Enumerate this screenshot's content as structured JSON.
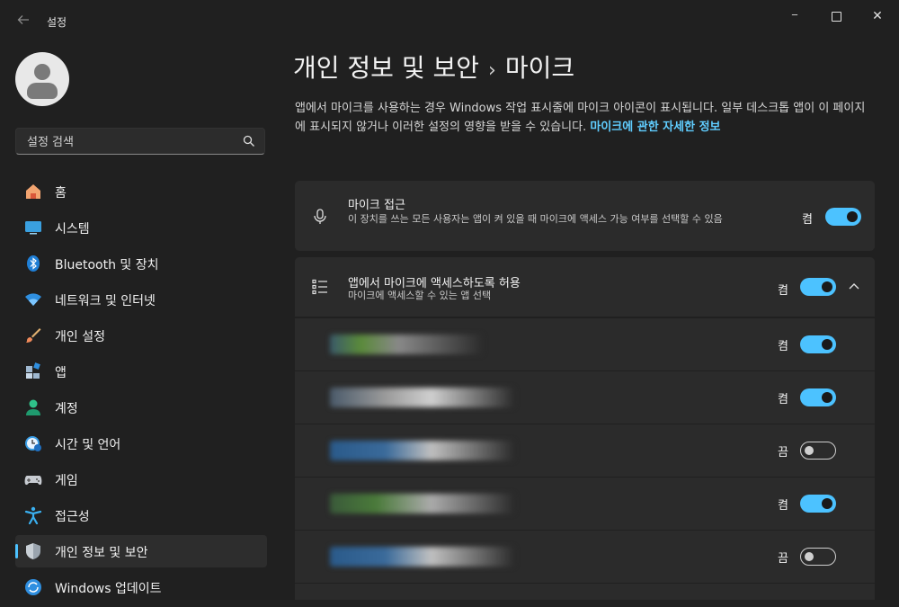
{
  "window": {
    "title": "설정",
    "minimize": "─",
    "close": "✕"
  },
  "search": {
    "placeholder": "설정 검색"
  },
  "sidebar": {
    "items": [
      {
        "label": "홈",
        "icon": "home-icon"
      },
      {
        "label": "시스템",
        "icon": "system-icon"
      },
      {
        "label": "Bluetooth 및 장치",
        "icon": "bluetooth-icon"
      },
      {
        "label": "네트워크 및 인터넷",
        "icon": "wifi-icon"
      },
      {
        "label": "개인 설정",
        "icon": "brush-icon"
      },
      {
        "label": "앱",
        "icon": "apps-icon"
      },
      {
        "label": "계정",
        "icon": "account-icon"
      },
      {
        "label": "시간 및 언어",
        "icon": "time-language-icon"
      },
      {
        "label": "게임",
        "icon": "gamepad-icon"
      },
      {
        "label": "접근성",
        "icon": "accessibility-icon"
      },
      {
        "label": "개인 정보 및 보안",
        "icon": "shield-icon",
        "active": true
      },
      {
        "label": "Windows 업데이트",
        "icon": "update-icon"
      }
    ]
  },
  "header": {
    "breadcrumb_parent": "개인 정보 및 보안",
    "separator": "›",
    "title": "마이크"
  },
  "description": {
    "text": "앱에서 마이크를 사용하는 경우 Windows 작업 표시줄에 마이크 아이콘이 표시됩니다. 일부 데스크톱 앱이 이 페이지에 표시되지 않거나 이러한 설정의 영향을 받을 수 있습니다. ",
    "link": "마이크에 관한 자세한 정보"
  },
  "mic_access": {
    "title": "마이크 접근",
    "subtitle": "이 장치를 쓰는 모든 사용자는 앱이 켜 있을 때 마이크에 액세스 가능 여부를 선택할 수 있음",
    "state": "켬",
    "on": true
  },
  "app_access": {
    "title": "앱에서 마이크에 액세스하도록 허용",
    "subtitle": "마이크에 액세스할 수 있는 앱 선택",
    "state": "켬",
    "on": true
  },
  "apps": [
    {
      "state": "켬",
      "on": true
    },
    {
      "state": "켬",
      "on": true
    },
    {
      "state": "끔",
      "on": false
    },
    {
      "state": "켬",
      "on": true
    },
    {
      "state": "끔",
      "on": false
    }
  ]
}
